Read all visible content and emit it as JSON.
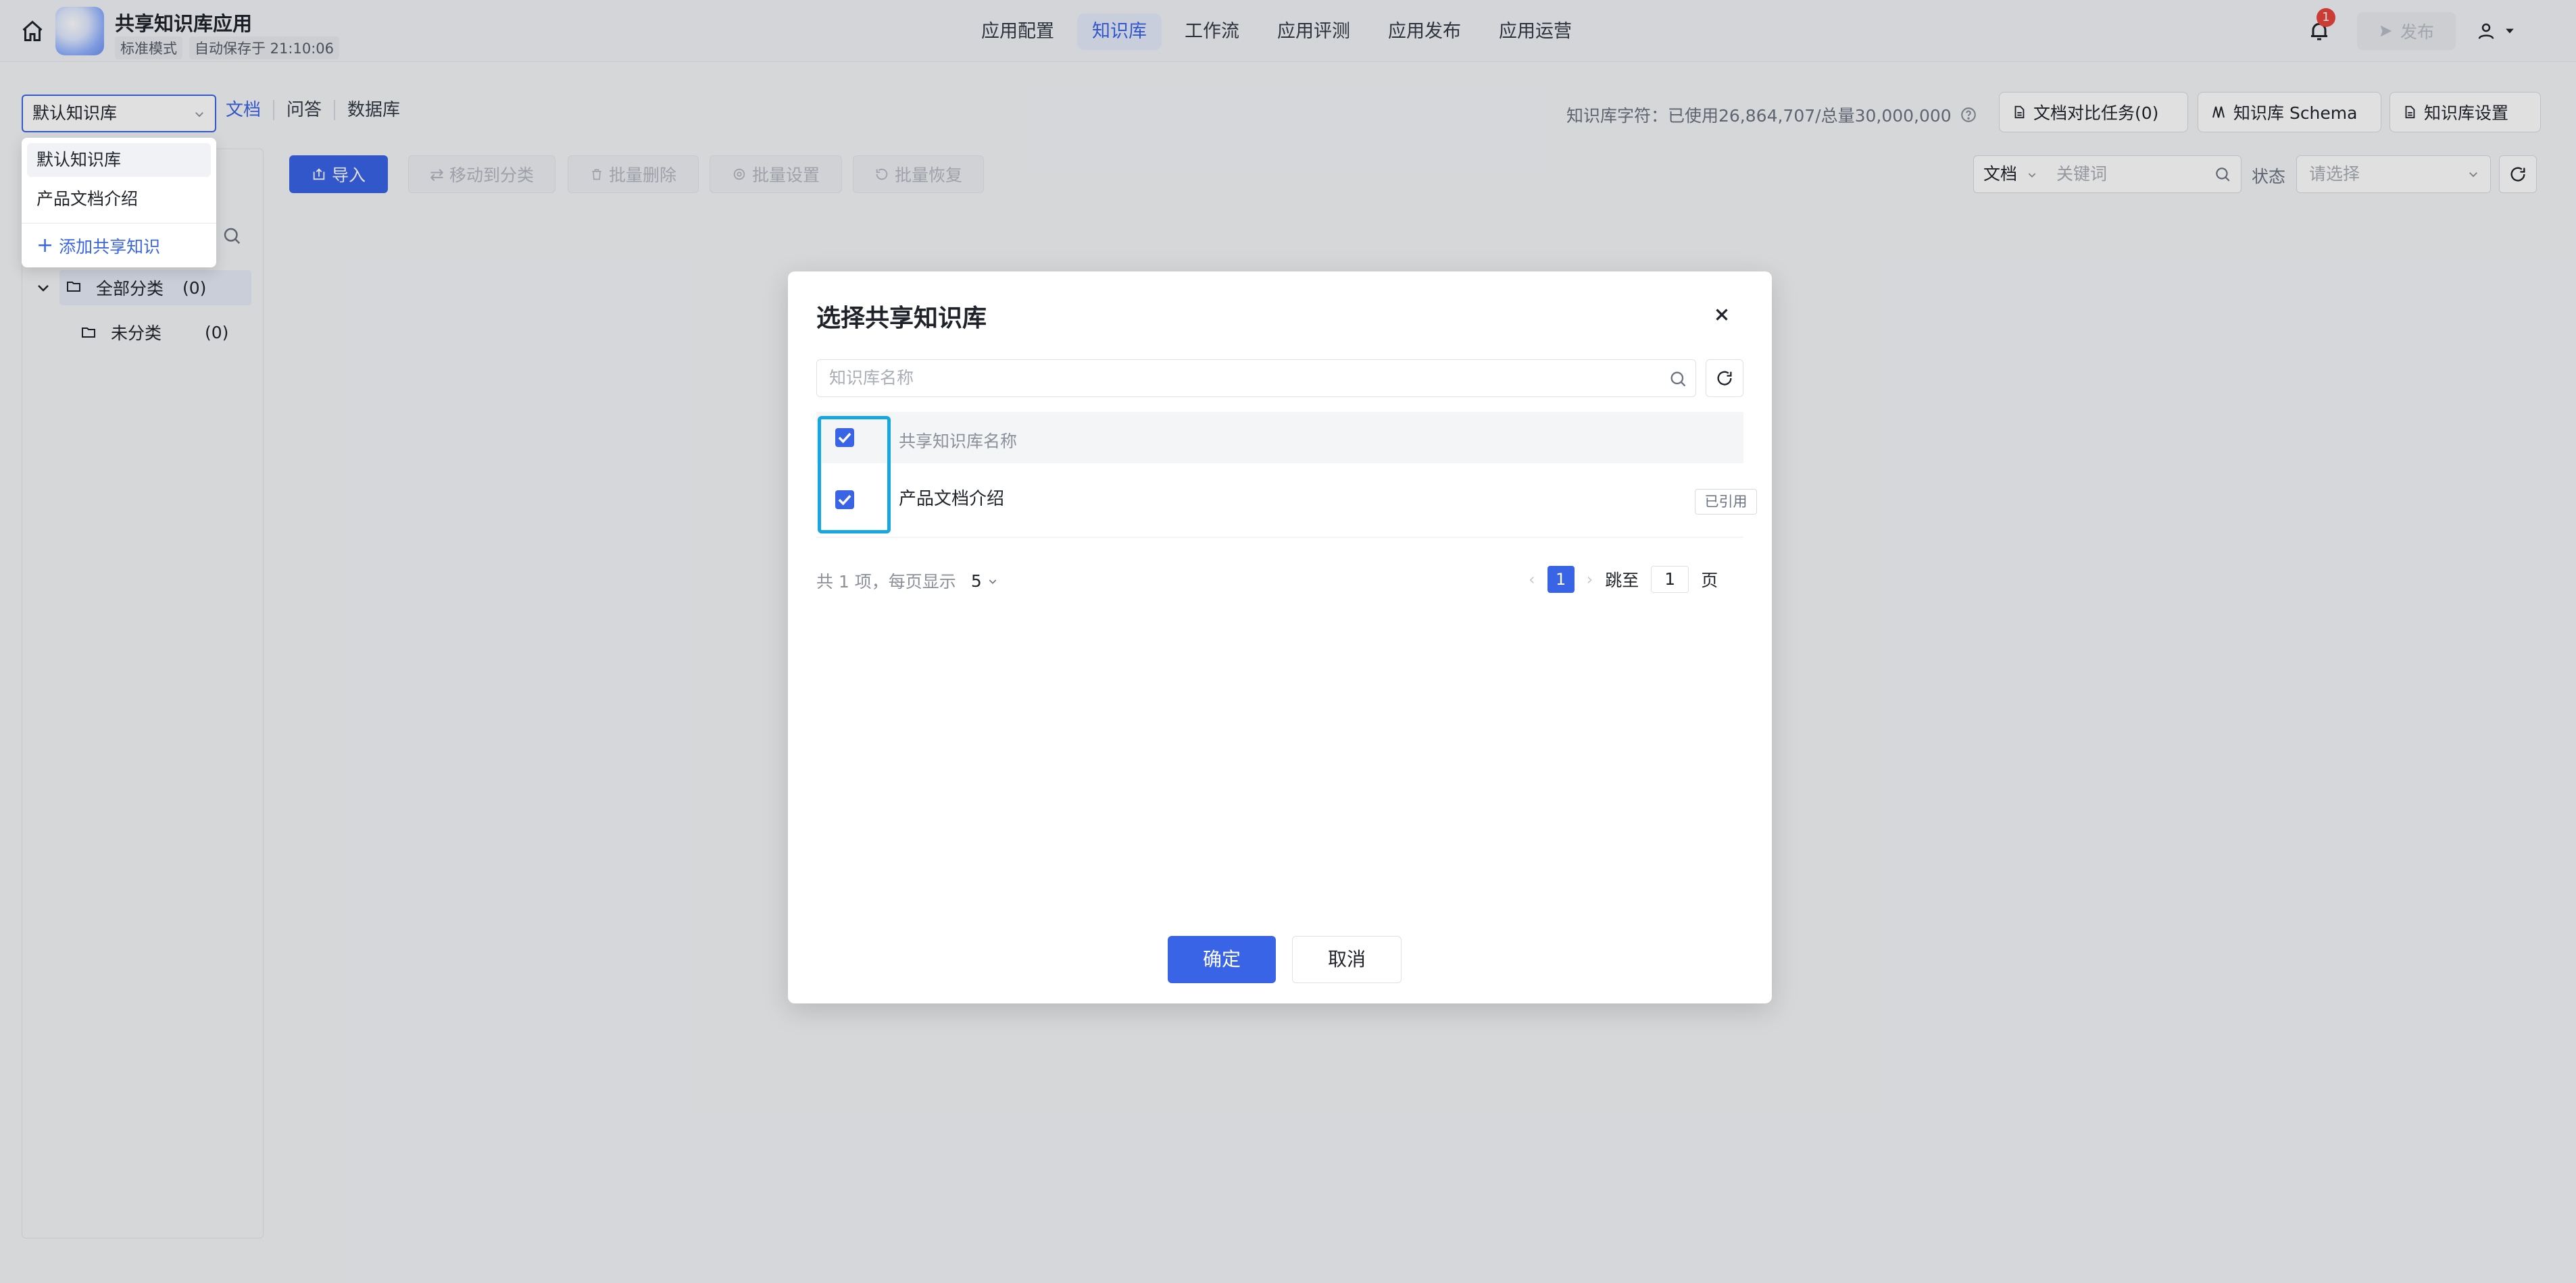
{
  "header": {
    "app_name": "共享知识库应用",
    "mode_label": "标准模式",
    "autosave_label": "自动保存于 21:10:06",
    "tabs": [
      "应用配置",
      "知识库",
      "工作流",
      "应用评测",
      "应用发布",
      "应用运营"
    ],
    "active_tab": "知识库",
    "notification_count": "1",
    "publish_label": "发布"
  },
  "kb_bar": {
    "selected_kb": "默认知识库",
    "sub_tabs": [
      "文档",
      "问答",
      "数据库"
    ],
    "usage_text": "知识库字符：已使用26,864,707/总量30,000,000",
    "buttons": {
      "compare": "文档对比任务(0)",
      "schema": "知识库 Schema",
      "settings": "知识库设置"
    }
  },
  "kb_dropdown": {
    "options": [
      "默认知识库",
      "产品文档介绍"
    ],
    "add_label": "添加共享知识"
  },
  "tree": {
    "all": {
      "label": "全部分类",
      "count": "(0)"
    },
    "uncategorized": {
      "label": "未分类",
      "count": "(0)"
    }
  },
  "toolbar": {
    "import": "导入",
    "move": "移动到分类",
    "batch_delete": "批量删除",
    "batch_settings": "批量设置",
    "batch_restore": "批量恢复"
  },
  "filters": {
    "type": "文档",
    "keyword_placeholder": "关键词",
    "status_label": "状态",
    "status_placeholder": "请选择"
  },
  "modal": {
    "title": "选择共享知识库",
    "search_placeholder": "知识库名称",
    "column_header": "共享知识库名称",
    "rows": [
      {
        "name": "产品文档介绍",
        "tag": "已引用"
      }
    ],
    "pager": {
      "total_text": "共 1 项，每页显示",
      "page_size": "5",
      "current_page": "1",
      "jump_label": "跳至",
      "jump_value": "1",
      "page_suffix": "页"
    },
    "ok_label": "确定",
    "cancel_label": "取消"
  },
  "colors": {
    "accent": "#3a64e6",
    "highlight": "#14a7e0",
    "badge": "#e8453c"
  }
}
